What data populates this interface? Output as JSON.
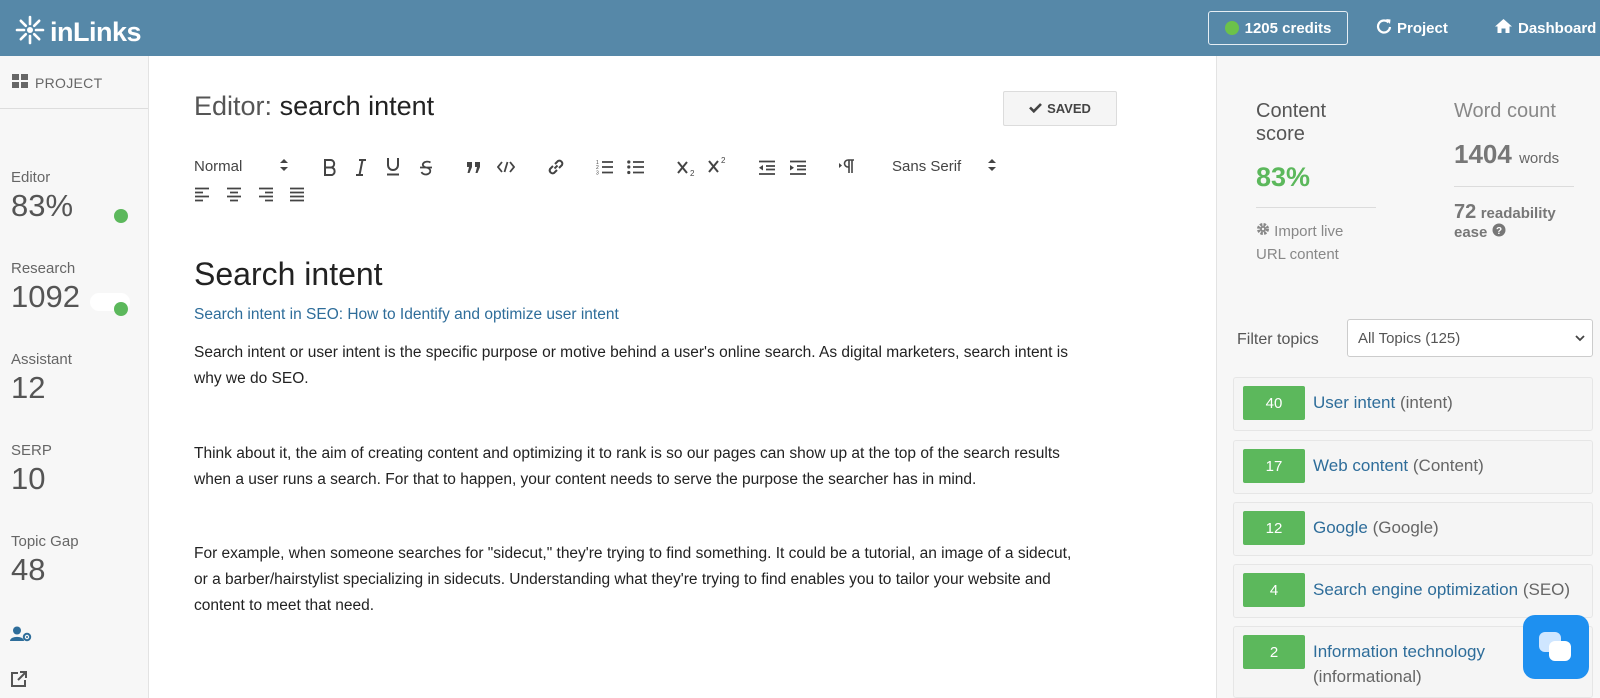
{
  "header": {
    "logo_text": "inLinks",
    "credits_label": "1205 credits",
    "project_label": "Project",
    "dashboard_label": "Dashboard",
    "brand_color": "#5688a8",
    "status_green": "#6cc24a"
  },
  "sidebar": {
    "project_label": "PROJECT",
    "metrics": [
      {
        "label": "Editor",
        "value": "83%"
      },
      {
        "label": "Research",
        "value": "1092"
      },
      {
        "label": "Assistant",
        "value": "12"
      },
      {
        "label": "SERP",
        "value": "10"
      },
      {
        "label": "Topic Gap",
        "value": "48"
      }
    ],
    "icons": [
      "users-cog-icon",
      "external-link-icon"
    ]
  },
  "editor": {
    "title_prefix": "Editor:",
    "title_keyword": "search intent",
    "saved_label": "SAVED",
    "toolbar": {
      "format_value": "Normal",
      "font_value": "Sans Serif"
    },
    "document": {
      "heading": "Search intent",
      "subtitle_link": "Search intent in SEO: How to Identify and optimize user intent",
      "paragraphs": [
        "Search intent or user intent is the specific purpose or motive behind a user's online search. As digital marketers, search intent is why we do SEO.",
        "Think about it, the aim of creating content and optimizing it to rank is so our pages can show up at the top of the search results when a user runs a search. For that to happen, your content needs to serve the purpose the searcher has in mind.",
        "For example, when someone searches for \"sidecut,\" they're trying to find something. It could be a tutorial, an image of a sidecut, or a barber/hairstylist specializing in sidecuts. Understanding what they're trying to find enables you to tailor your website and content to meet that need."
      ]
    }
  },
  "right_panel": {
    "content_score_label": "Content score",
    "content_score_value": "83%",
    "import_label": "Import live URL content",
    "word_count_label": "Word count",
    "word_count_value": "1404",
    "word_count_unit": "words",
    "readability_value": "72",
    "readability_label": "readability ease",
    "filter_label": "Filter topics",
    "filter_value": "All Topics (125)",
    "topics": [
      {
        "count": "40",
        "name": "User intent",
        "type": "(intent)"
      },
      {
        "count": "17",
        "name": "Web content",
        "type": "(Content)"
      },
      {
        "count": "12",
        "name": "Google",
        "type": "(Google)"
      },
      {
        "count": "4",
        "name": "Search engine optimization",
        "type": "(SEO)"
      },
      {
        "count": "2",
        "name": "Information technology",
        "type": "(informational)"
      }
    ],
    "score_color": "#5cb85c",
    "link_color": "#2e6d9a"
  }
}
